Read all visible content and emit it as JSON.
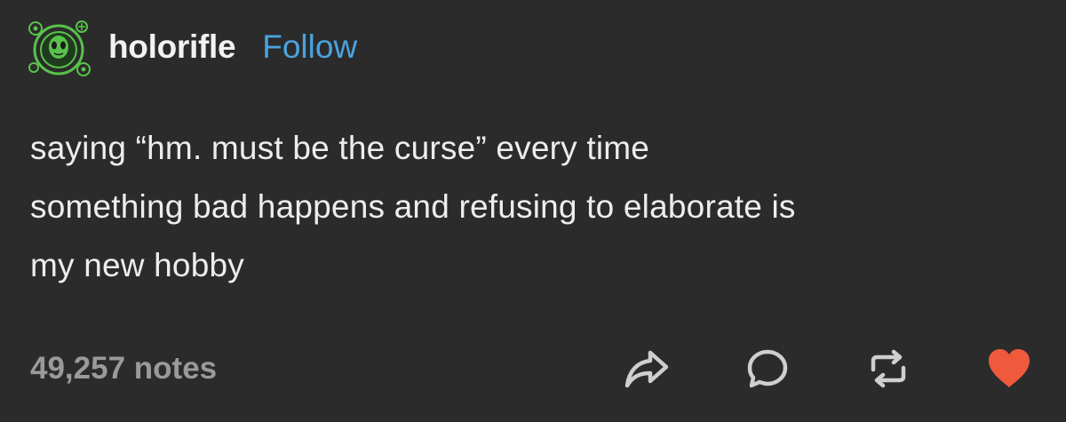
{
  "post": {
    "username": "holorifle",
    "follow_label": "Follow",
    "body_lines": [
      "saying “hm. must be the curse” every time",
      "something bad happens and refusing to elaborate is",
      "my new hobby"
    ],
    "notes": "49,257 notes"
  },
  "icons": {
    "avatar": "green-alien-avatar-icon",
    "share": "share-arrow-icon",
    "reply": "reply-bubble-icon",
    "reblog": "reblog-icon",
    "like": "heart-icon"
  },
  "colors": {
    "background": "#2b2b2b",
    "text": "#ededed",
    "follow": "#4aa3df",
    "notes": "#9a9a9a",
    "heart": "#ef5a3c",
    "icon": "#cfcfcf",
    "avatar_green": "#58c24a"
  }
}
